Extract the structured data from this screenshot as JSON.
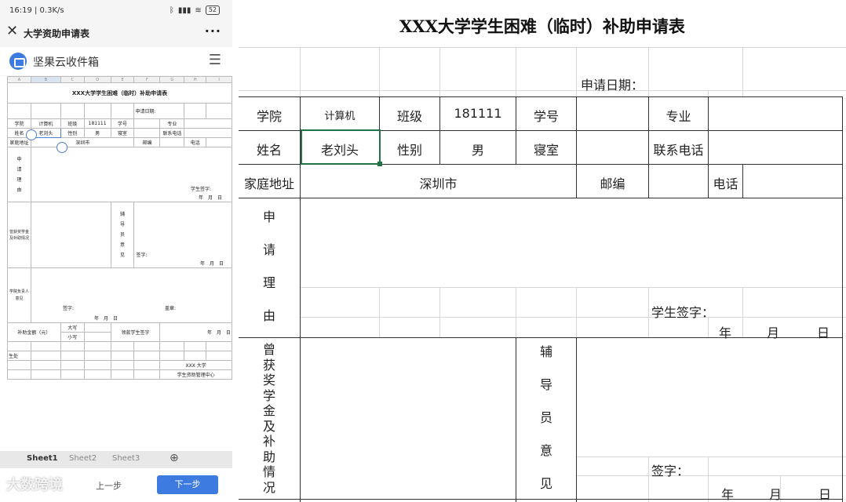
{
  "status_bar": {
    "time_speed": "16:19 | 0.3K/s",
    "battery": "52"
  },
  "titlebar": {
    "close": "✕",
    "title": "大学资助申请表",
    "more": "···"
  },
  "app": {
    "name": "坚果云收件箱",
    "menu": "☰"
  },
  "mini_sheet": {
    "columns": [
      "A",
      "B",
      "C",
      "D",
      "E",
      "F",
      "G",
      "H",
      "I"
    ],
    "title": "XXX大学学生困难（临时）补助申请表",
    "apply_date": "申请日期:",
    "row4": [
      "学院",
      "计算机",
      "班级",
      "181111",
      "学号",
      "",
      "专业",
      ""
    ],
    "row5": [
      "姓名",
      "老刘头",
      "性别",
      "男",
      "寝室",
      "",
      "联系电话",
      ""
    ],
    "row6": [
      "家庭地址",
      "深圳市",
      "邮编",
      "",
      "电话",
      ""
    ],
    "reason": [
      "申",
      "请",
      "理",
      "由"
    ],
    "student_sign": "学生签字:",
    "ymd": "年　月　日",
    "awards_label": "曾获奖学金及补助情况",
    "counselor": [
      "辅",
      "导",
      "员",
      "意",
      "见"
    ],
    "sign": "签字:",
    "college": "学院负责人意见",
    "stamp": "盖章:",
    "amount": "补助金额（元）",
    "upper": "大写",
    "lower": "小写",
    "receiver": "领款学生签字",
    "office": "生处",
    "univ": "XXX 大学",
    "center": "学生资助管理中心"
  },
  "sheet_tabs": [
    "Sheet1",
    "Sheet2",
    "Sheet3"
  ],
  "add_sheet": "⊕",
  "bottom": {
    "prev": "上一步",
    "next": "下一步",
    "watermark": "大数跨境"
  },
  "form": {
    "title": "XXX大学学生困难（临时）补助申请表",
    "apply_date_label": "申请日期：",
    "row1": {
      "college_label": "学院",
      "college": "计算机",
      "class_label": "班级",
      "class": "181111",
      "student_no_label": "学号",
      "major_label": "专业"
    },
    "row2": {
      "name_label": "姓名",
      "name": "老刘头",
      "gender_label": "性别",
      "gender": "男",
      "dorm_label": "寝室",
      "phone_label": "联系电话"
    },
    "row3": {
      "address_label": "家庭地址",
      "address": "深圳市",
      "zip_label": "邮编",
      "tel_label": "电话"
    },
    "reason_chars": [
      "申",
      "请",
      "理",
      "由"
    ],
    "student_sign": "学生签字：",
    "year": "年",
    "month": "月",
    "day": "日",
    "awards_chars": [
      "曾",
      "获",
      "奖",
      "学",
      "金",
      "及",
      "补",
      "助",
      "情",
      "况"
    ],
    "counselor_chars": [
      "辅",
      "导",
      "员",
      "意",
      "见"
    ],
    "sign": "签字："
  }
}
